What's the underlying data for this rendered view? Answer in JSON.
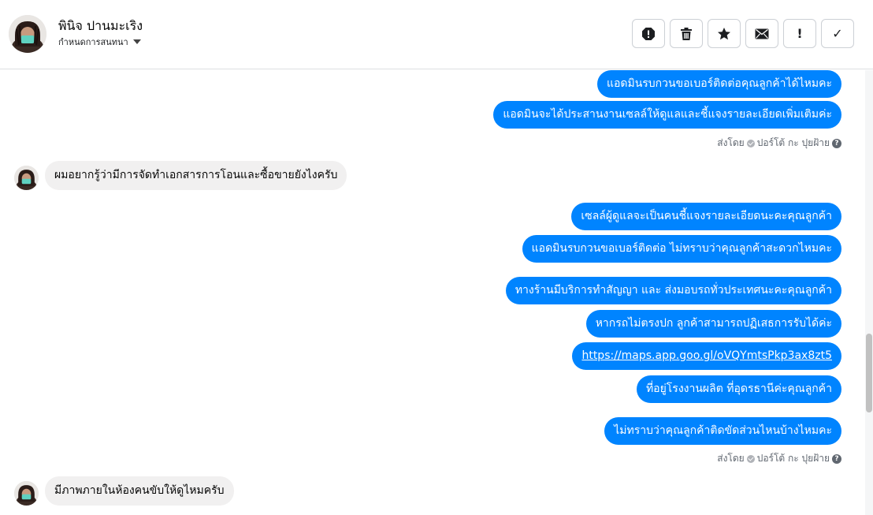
{
  "header": {
    "contact_name": "พินิจ ปานมะเริง",
    "assign_label": "กำหนดการสนทนา",
    "actions": {
      "spam": "!",
      "done": "✓"
    }
  },
  "messages": [
    {
      "text": "แอดมินรบกวนขอเบอร์ติดต่อคุณลูกค้าได้ไหมคะ"
    },
    {
      "text": "แอดมินจะได้ประสานงานเซลล์ให้ดูแลและชี้แจงรายละเอียดเพิ่มเติมค่ะ"
    },
    {
      "sent_by": "ส่งโดย",
      "sender": "ปอร์โต้ กะ ปุยฝ้าย"
    },
    {
      "text": "ผมอยากรู้ว่ามีการจัดทำเอกสารการโอนและซื้อขายยังไงครับ"
    },
    {
      "text": "เซลล์ผู้ดูแลจะเป็นคนชี้แจงรายละเอียดนะคะคุณลูกค้า"
    },
    {
      "text": "แอดมินรบกวนขอเบอร์ติดต่อ ไม่ทราบว่าคุณลูกค้าสะดวกไหมคะ"
    },
    {
      "text": "ทางร้านมีบริการทำสัญญา และ ส่งมอบรถทั่วประเทศนะคะคุณลูกค้า"
    },
    {
      "text": "หากรถไม่ตรงปก ลูกค้าสามารถปฏิเสธการรับได้ค่ะ"
    },
    {
      "text": "https://maps.app.goo.gl/oVQYmtsPkp3ax8zt5"
    },
    {
      "text": "ที่อยู่โรงงานผลิต ที่อุดรธานีค่ะคุณลูกค้า"
    },
    {
      "text": "ไม่ทราบว่าคุณลูกค้าติดขัดส่วนไหนบ้างไหมคะ"
    },
    {
      "sent_by": "ส่งโดย",
      "sender": "ปอร์โต้ กะ ปุยฝ้าย"
    },
    {
      "text": "มีภาพภายในห้องคนขับให้ดูไหมครับ"
    }
  ],
  "colors": {
    "outgoing_bubble": "#0084ff",
    "incoming_bubble": "#f1f0f0"
  }
}
